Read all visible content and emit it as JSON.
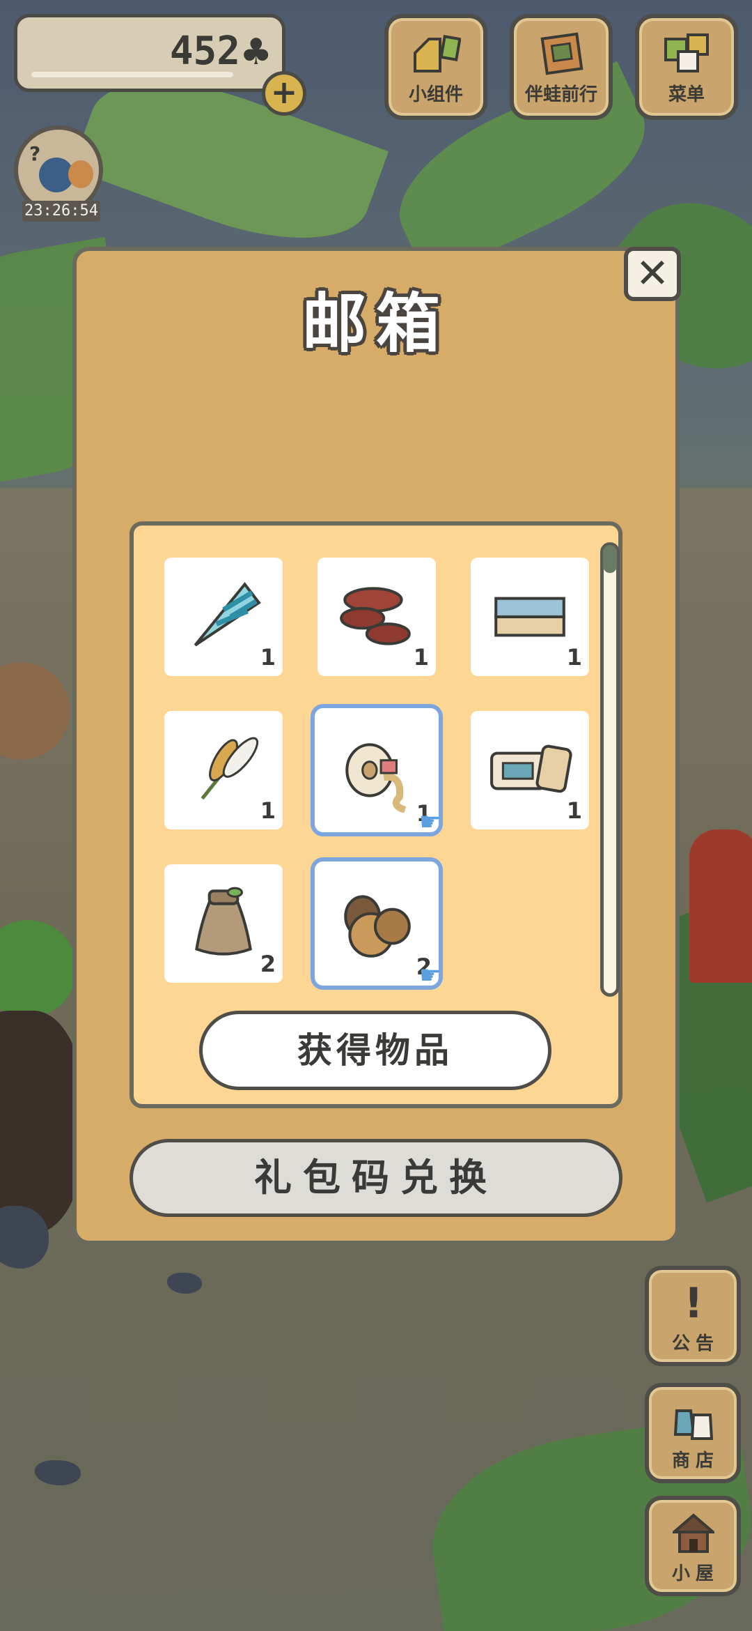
{
  "hud": {
    "clover_count": "452",
    "clover_icon": "♣",
    "plus_symbol": "+",
    "timer": "23:26:54",
    "avatar_symbol": "?"
  },
  "top_buttons": [
    {
      "label": "小组件",
      "icon": "widget-icon"
    },
    {
      "label": "伴蛙前行",
      "icon": "album-icon"
    },
    {
      "label": "菜单",
      "icon": "menu-icon"
    }
  ],
  "side_buttons": [
    {
      "label": "公告",
      "icon": "exclamation-icon",
      "symbol": "!"
    },
    {
      "label": "商店",
      "icon": "shop-bags-icon"
    },
    {
      "label": "小屋",
      "icon": "house-icon"
    }
  ],
  "mailbox": {
    "title": "邮箱",
    "close_symbol": "✕",
    "items": [
      {
        "name": "蓝色海螺",
        "icon": "seashell-icon",
        "count": "1"
      },
      {
        "name": "木片",
        "icon": "wood-slices-icon",
        "count": "1"
      },
      {
        "name": "布料",
        "icon": "folded-cloth-icon",
        "count": "1"
      },
      {
        "name": "羽毛",
        "icon": "feather-bouquet-icon",
        "count": "1"
      },
      {
        "name": "丝带卷",
        "icon": "ribbon-roll-icon",
        "count": "1",
        "selected": true
      },
      {
        "name": "票",
        "icon": "ticket-icon",
        "count": "1"
      },
      {
        "name": "种子袋",
        "icon": "seed-bag-icon",
        "count": "2"
      },
      {
        "name": "坚果",
        "icon": "nuts-icon",
        "count": "2",
        "selected": true
      }
    ],
    "obtain_label": "获得物品",
    "gift_code_label": "礼包码兑换"
  }
}
